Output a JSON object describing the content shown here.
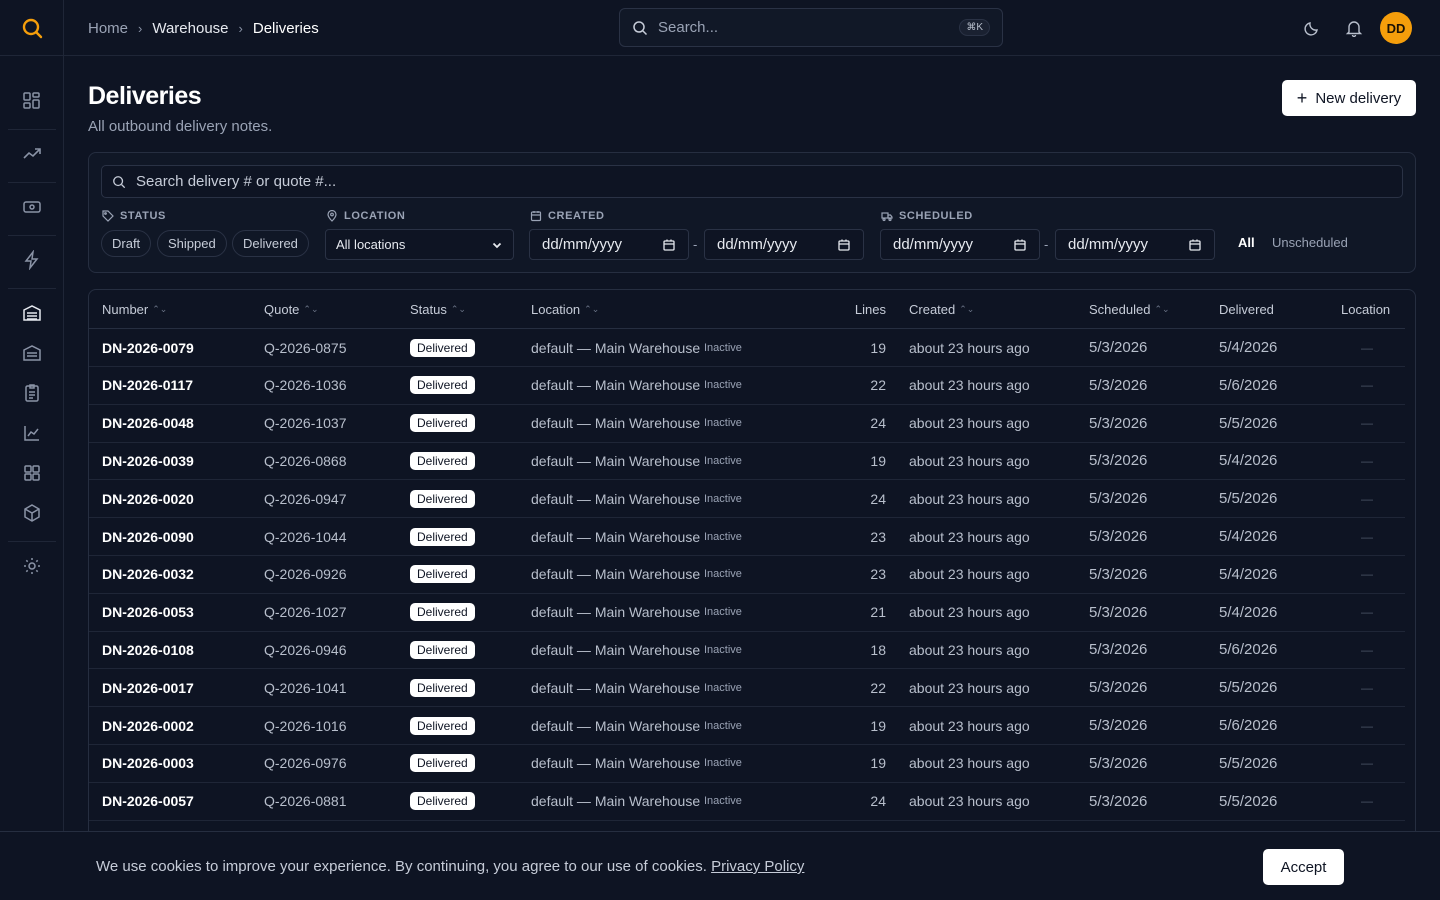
{
  "breadcrumb": {
    "home": "Home",
    "section": "Warehouse",
    "current": "Deliveries",
    "sep": "›"
  },
  "search": {
    "placeholder": "Search...",
    "shortcut": "⌘K"
  },
  "user": {
    "initials": "DD"
  },
  "page": {
    "title": "Deliveries",
    "subtitle": "All outbound delivery notes.",
    "new_button": "New delivery",
    "new_icon": "+"
  },
  "filters": {
    "search_placeholder": "Search delivery # or quote #...",
    "status_label": "STATUS",
    "status_options": [
      "Draft",
      "Shipped",
      "Delivered"
    ],
    "location_label": "LOCATION",
    "location_value": "All locations",
    "created_label": "CREATED",
    "scheduled_label": "SCHEDULED",
    "date_placeholder": "dd/mm/yyyy",
    "dash": "-",
    "toggle_all": "All",
    "toggle_unscheduled": "Unscheduled"
  },
  "table": {
    "columns": [
      "Number",
      "Quote",
      "Status",
      "Location",
      "Lines",
      "Created",
      "Scheduled",
      "Delivered",
      "Location"
    ],
    "sort_glyph": "⌃⌄",
    "rows": [
      {
        "number": "DN-2026-0079",
        "quote": "Q-2026-0875",
        "status": "Delivered",
        "location": "default — Main Warehouse",
        "tag": "Inactive",
        "lines": "19",
        "created": "about 23 hours ago",
        "scheduled": "5/3/2026",
        "delivered": "5/4/2026",
        "delivered_location": "—"
      },
      {
        "number": "DN-2026-0117",
        "quote": "Q-2026-1036",
        "status": "Delivered",
        "location": "default — Main Warehouse",
        "tag": "Inactive",
        "lines": "22",
        "created": "about 23 hours ago",
        "scheduled": "5/3/2026",
        "delivered": "5/6/2026",
        "delivered_location": "—"
      },
      {
        "number": "DN-2026-0048",
        "quote": "Q-2026-1037",
        "status": "Delivered",
        "location": "default — Main Warehouse",
        "tag": "Inactive",
        "lines": "24",
        "created": "about 23 hours ago",
        "scheduled": "5/3/2026",
        "delivered": "5/5/2026",
        "delivered_location": "—"
      },
      {
        "number": "DN-2026-0039",
        "quote": "Q-2026-0868",
        "status": "Delivered",
        "location": "default — Main Warehouse",
        "tag": "Inactive",
        "lines": "19",
        "created": "about 23 hours ago",
        "scheduled": "5/3/2026",
        "delivered": "5/4/2026",
        "delivered_location": "—"
      },
      {
        "number": "DN-2026-0020",
        "quote": "Q-2026-0947",
        "status": "Delivered",
        "location": "default — Main Warehouse",
        "tag": "Inactive",
        "lines": "24",
        "created": "about 23 hours ago",
        "scheduled": "5/3/2026",
        "delivered": "5/5/2026",
        "delivered_location": "—"
      },
      {
        "number": "DN-2026-0090",
        "quote": "Q-2026-1044",
        "status": "Delivered",
        "location": "default — Main Warehouse",
        "tag": "Inactive",
        "lines": "23",
        "created": "about 23 hours ago",
        "scheduled": "5/3/2026",
        "delivered": "5/4/2026",
        "delivered_location": "—"
      },
      {
        "number": "DN-2026-0032",
        "quote": "Q-2026-0926",
        "status": "Delivered",
        "location": "default — Main Warehouse",
        "tag": "Inactive",
        "lines": "23",
        "created": "about 23 hours ago",
        "scheduled": "5/3/2026",
        "delivered": "5/4/2026",
        "delivered_location": "—"
      },
      {
        "number": "DN-2026-0053",
        "quote": "Q-2026-1027",
        "status": "Delivered",
        "location": "default — Main Warehouse",
        "tag": "Inactive",
        "lines": "21",
        "created": "about 23 hours ago",
        "scheduled": "5/3/2026",
        "delivered": "5/4/2026",
        "delivered_location": "—"
      },
      {
        "number": "DN-2026-0108",
        "quote": "Q-2026-0946",
        "status": "Delivered",
        "location": "default — Main Warehouse",
        "tag": "Inactive",
        "lines": "18",
        "created": "about 23 hours ago",
        "scheduled": "5/3/2026",
        "delivered": "5/6/2026",
        "delivered_location": "—"
      },
      {
        "number": "DN-2026-0017",
        "quote": "Q-2026-1041",
        "status": "Delivered",
        "location": "default — Main Warehouse",
        "tag": "Inactive",
        "lines": "22",
        "created": "about 23 hours ago",
        "scheduled": "5/3/2026",
        "delivered": "5/5/2026",
        "delivered_location": "—"
      },
      {
        "number": "DN-2026-0002",
        "quote": "Q-2026-1016",
        "status": "Delivered",
        "location": "default — Main Warehouse",
        "tag": "Inactive",
        "lines": "19",
        "created": "about 23 hours ago",
        "scheduled": "5/3/2026",
        "delivered": "5/6/2026",
        "delivered_location": "—"
      },
      {
        "number": "DN-2026-0003",
        "quote": "Q-2026-0976",
        "status": "Delivered",
        "location": "default — Main Warehouse",
        "tag": "Inactive",
        "lines": "19",
        "created": "about 23 hours ago",
        "scheduled": "5/3/2026",
        "delivered": "5/5/2026",
        "delivered_location": "—"
      },
      {
        "number": "DN-2026-0057",
        "quote": "Q-2026-0881",
        "status": "Delivered",
        "location": "default — Main Warehouse",
        "tag": "Inactive",
        "lines": "24",
        "created": "about 23 hours ago",
        "scheduled": "5/3/2026",
        "delivered": "5/5/2026",
        "delivered_location": "—"
      }
    ]
  },
  "cookie": {
    "text": "We use cookies to improve your experience. By continuing, you agree to our use of cookies.",
    "link": "Privacy Policy",
    "accept": "Accept"
  },
  "icons": {
    "logo": "search-logo-icon",
    "sidebar": [
      "dashboard-icon",
      "trending-icon",
      "banknote-icon",
      "lightning-icon",
      "warehouse-icon",
      "warehouse-alt-icon",
      "clipboard-icon",
      "chart-icon",
      "grid-icon",
      "package-icon",
      "gear-icon"
    ],
    "top": [
      "moon-icon",
      "bell-icon"
    ]
  },
  "colors": {
    "accent": "#f59e0b",
    "background": "#0e1423",
    "badge": "#ffffff"
  }
}
